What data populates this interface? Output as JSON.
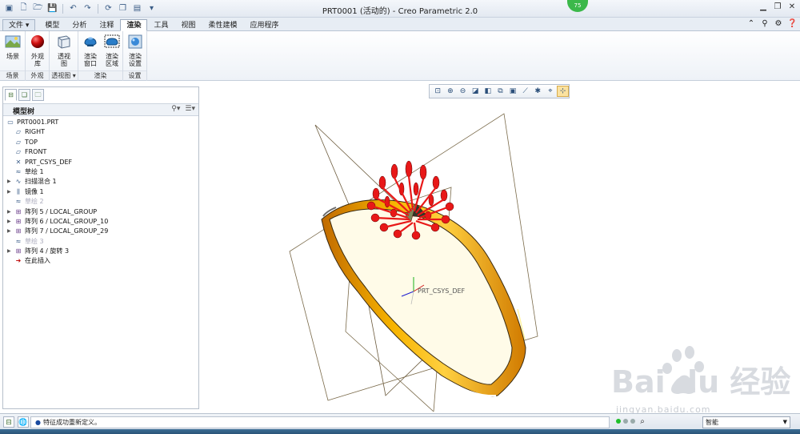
{
  "window": {
    "title": "PRT0001 (活动的) - Creo Parametric 2.0",
    "badge": "75"
  },
  "ribbon": {
    "file_tab": "文件",
    "tabs": [
      "模型",
      "分析",
      "注释",
      "渲染",
      "工具",
      "视图",
      "柔性建模",
      "应用程序"
    ],
    "active_tab": "渲染",
    "buttons": {
      "scene": "场景",
      "appearance": "外观\n库",
      "perspective": "透视\n图",
      "render_window": "渲染\n窗口",
      "render_region": "渲染\n区域",
      "render_setup": "渲染\n设置"
    },
    "groups": {
      "scene": "场景",
      "appearance": "外观",
      "perspective": "透视图",
      "render": "渲染",
      "settings": "设置"
    }
  },
  "model_tree": {
    "header": "模型树",
    "nodes": [
      {
        "label": "PRT0001.PRT",
        "icon": "part-icon",
        "expandable": false,
        "dim": false
      },
      {
        "label": "RIGHT",
        "icon": "datum-plane-icon",
        "expandable": false,
        "dim": false
      },
      {
        "label": "TOP",
        "icon": "datum-plane-icon",
        "expandable": false,
        "dim": false
      },
      {
        "label": "FRONT",
        "icon": "datum-plane-icon",
        "expandable": false,
        "dim": false
      },
      {
        "label": "PRT_CSYS_DEF",
        "icon": "csys-icon",
        "expandable": false,
        "dim": false
      },
      {
        "label": "草绘 1",
        "icon": "sketch-icon",
        "expandable": false,
        "dim": false
      },
      {
        "label": "扫描混合 1",
        "icon": "sweep-blend-icon",
        "expandable": true,
        "dim": false
      },
      {
        "label": "镜像 1",
        "icon": "mirror-icon",
        "expandable": true,
        "dim": false
      },
      {
        "label": "草绘 2",
        "icon": "sketch-icon",
        "expandable": false,
        "dim": true
      },
      {
        "label": "阵列 5 / LOCAL_GROUP",
        "icon": "pattern-icon",
        "expandable": true,
        "dim": false
      },
      {
        "label": "阵列 6 / LOCAL_GROUP_10",
        "icon": "pattern-icon",
        "expandable": true,
        "dim": false
      },
      {
        "label": "阵列 7 / LOCAL_GROUP_29",
        "icon": "pattern-icon",
        "expandable": true,
        "dim": false
      },
      {
        "label": "草绘 3",
        "icon": "sketch-icon",
        "expandable": false,
        "dim": true
      },
      {
        "label": "阵列 4 / 旋转 3",
        "icon": "pattern-icon",
        "expandable": true,
        "dim": false
      },
      {
        "label": "在此插入",
        "icon": "insert-arrow-icon",
        "expandable": false,
        "dim": false
      }
    ]
  },
  "graphics": {
    "csys_label": "PRT_CSYS_DEF"
  },
  "status": {
    "message": "特征成功重新定义。",
    "filter_value": "智能"
  },
  "watermark": {
    "brand": "Bai du 经验",
    "url": "jingyan.baidu.com"
  },
  "colors": {
    "ring": "#f2a900",
    "petals": "#e81818",
    "accent": "#2d5d9a"
  }
}
